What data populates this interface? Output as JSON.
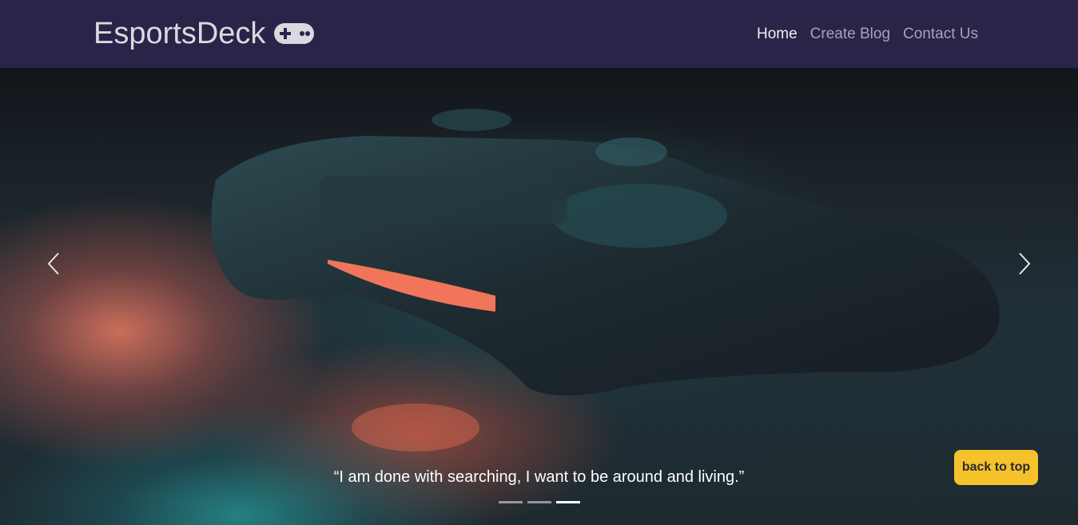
{
  "navbar": {
    "brand": "EsportsDeck",
    "brand_icon": "gamepad-icon",
    "links": [
      {
        "label": "Home",
        "active": true
      },
      {
        "label": "Create Blog",
        "active": false
      },
      {
        "label": "Contact Us",
        "active": false
      }
    ]
  },
  "carousel": {
    "caption": "“I am done with searching, I want to be around and living.”",
    "prev_icon": "chevron-left-icon",
    "next_icon": "chevron-right-icon",
    "slide_count": 3,
    "active_slide": 3
  },
  "back_to_top": {
    "label": "back to top"
  },
  "colors": {
    "navbar_bg": "#2b2348",
    "back_to_top_bg": "#f5c22c"
  }
}
